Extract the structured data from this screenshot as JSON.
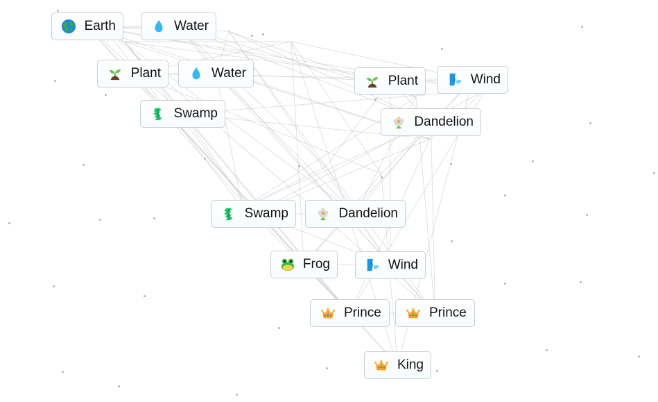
{
  "canvas": {
    "items": [
      {
        "id": "earth-1",
        "label": "Earth",
        "icon": "earth-globe-icon"
      },
      {
        "id": "water-1",
        "label": "Water",
        "icon": "water-drop-icon"
      },
      {
        "id": "plant-1",
        "label": "Plant",
        "icon": "seedling-icon"
      },
      {
        "id": "water-2",
        "label": "Water",
        "icon": "water-drop-icon"
      },
      {
        "id": "swamp-1",
        "label": "Swamp",
        "icon": "swamp-creature-icon"
      },
      {
        "id": "plant-2",
        "label": "Plant",
        "icon": "seedling-icon"
      },
      {
        "id": "wind-1",
        "label": "Wind",
        "icon": "wind-face-icon"
      },
      {
        "id": "dandelion-1",
        "label": "Dandelion",
        "icon": "flower-icon"
      },
      {
        "id": "swamp-2",
        "label": "Swamp",
        "icon": "swamp-creature-icon"
      },
      {
        "id": "dandelion-2",
        "label": "Dandelion",
        "icon": "flower-icon"
      },
      {
        "id": "frog-1",
        "label": "Frog",
        "icon": "frog-face-icon"
      },
      {
        "id": "wind-2",
        "label": "Wind",
        "icon": "wind-face-icon"
      },
      {
        "id": "prince-1",
        "label": "Prince",
        "icon": "crown-icon"
      },
      {
        "id": "prince-2",
        "label": "Prince",
        "icon": "crown-icon"
      },
      {
        "id": "king-1",
        "label": "King",
        "icon": "crown-icon"
      }
    ]
  }
}
